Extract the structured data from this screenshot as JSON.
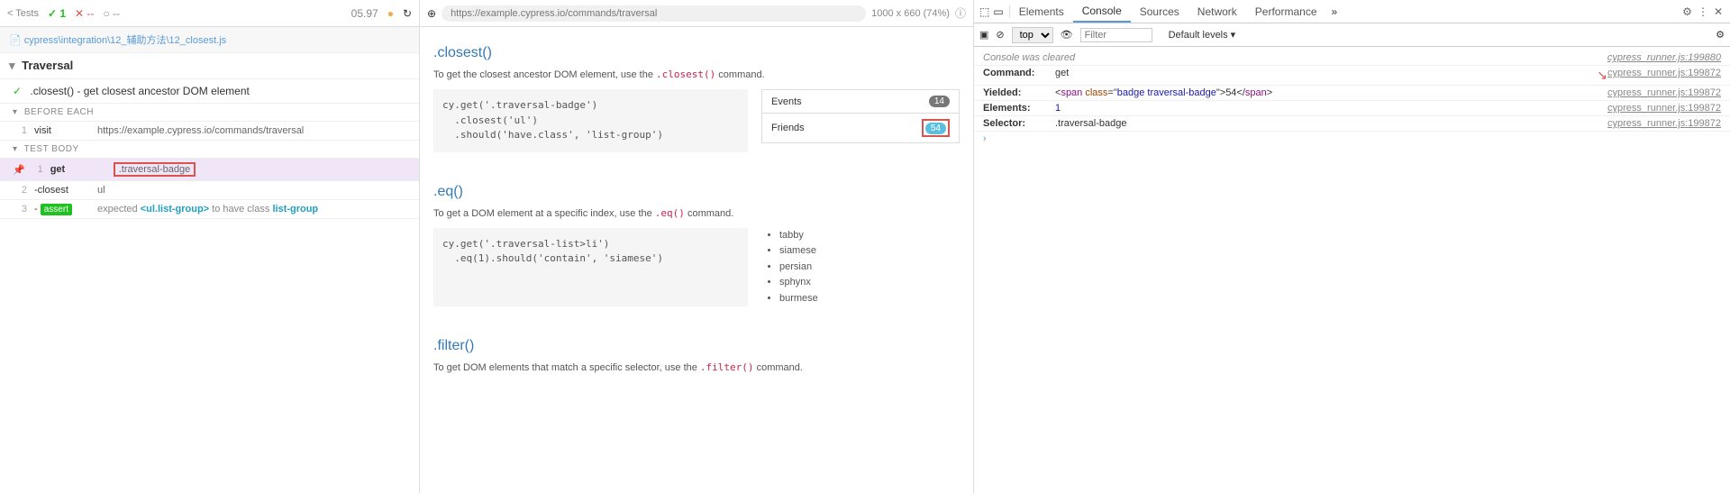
{
  "header": {
    "back": "< Tests",
    "pass_count": "1",
    "fail": "✕ --",
    "pending": "○ --",
    "time": "05.97"
  },
  "file_path": "cypress\\integration\\12_辅助方法\\12_closest.js",
  "suite_title": "Traversal",
  "test_name": ".closest() - get closest ancestor DOM element",
  "sections": {
    "before_each": "BEFORE EACH",
    "test_body": "TEST BODY"
  },
  "commands": [
    {
      "num": "1",
      "name": "visit",
      "arg": "https://example.cypress.io/commands/traversal"
    },
    {
      "num": "1",
      "name": "get",
      "arg": ".traversal-badge",
      "pinned": true,
      "redbox": true
    },
    {
      "num": "2",
      "name": "-closest",
      "arg": "ul"
    },
    {
      "num": "3",
      "name": "-assert",
      "arg_parts": {
        "prefix": "expected ",
        "subj": "<ul.list-group>",
        "mid": " to have class ",
        "cls": "list-group"
      }
    }
  ],
  "url_bar": {
    "url": "https://example.cypress.io/commands/traversal",
    "viewport": "1000 x 660 (74%)"
  },
  "content": {
    "closest": {
      "title": ".closest()",
      "desc_prefix": "To get the closest ancestor DOM element, use the ",
      "desc_code": ".closest()",
      "desc_suffix": " command.",
      "code": "cy.get('.traversal-badge')\n  .closest('ul')\n  .should('have.class', 'list-group')",
      "items": [
        {
          "label": "Events",
          "badge": "14"
        },
        {
          "label": "Friends",
          "badge": "54",
          "highlight": true
        }
      ]
    },
    "eq": {
      "title": ".eq()",
      "desc_prefix": "To get a DOM element at a specific index, use the ",
      "desc_code": ".eq()",
      "desc_suffix": " command.",
      "code": "cy.get('.traversal-list>li')\n  .eq(1).should('contain', 'siamese')",
      "cats": [
        "tabby",
        "siamese",
        "persian",
        "sphynx",
        "burmese"
      ]
    },
    "filter": {
      "title": ".filter()",
      "desc_prefix": "To get DOM elements that match a specific selector, use the ",
      "desc_code": ".filter()",
      "desc_suffix": " command."
    }
  },
  "devtools": {
    "tabs": [
      "Elements",
      "Console",
      "Sources",
      "Network",
      "Performance"
    ],
    "active_tab": "Console",
    "context": "top",
    "filter_placeholder": "Filter",
    "levels": "Default levels ▾",
    "lines": [
      {
        "cleared": "Console was cleared",
        "src": "cypress_runner.js:199880"
      },
      {
        "label": "Command:",
        "value": "get",
        "src": "cypress_runner.js:199872"
      },
      {
        "label": "Yielded:",
        "html": true,
        "src": "cypress_runner.js:199872"
      },
      {
        "label": "Elements:",
        "value": "1",
        "num": true,
        "src": "cypress_runner.js:199872"
      },
      {
        "label": "Selector:",
        "value": ".traversal-badge",
        "src": "cypress_runner.js:199872"
      }
    ],
    "yielded_html": {
      "tag": "span",
      "class": "badge traversal-badge",
      "text": "54"
    }
  }
}
